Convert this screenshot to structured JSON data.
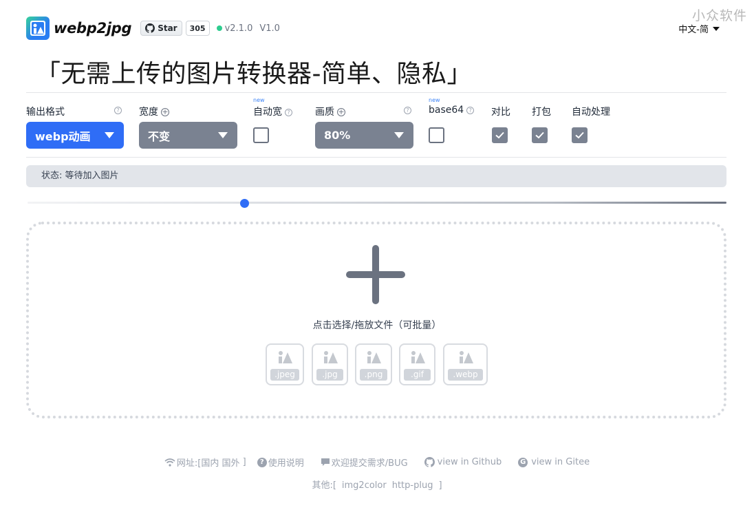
{
  "watermark": "小众软件",
  "header": {
    "brand": "webp2jpg",
    "star_label": "Star",
    "star_count": "305",
    "version": "v2.1.0",
    "version2": "V1.0",
    "language": "中文-简"
  },
  "title": "「无需上传的图片转换器-简单、隐私」",
  "options": {
    "output_format": {
      "label": "输出格式",
      "value": "webp动画"
    },
    "width": {
      "label": "宽度",
      "value": "不变"
    },
    "auto_width": {
      "new": "new",
      "label": "自动宽",
      "checked": false
    },
    "quality": {
      "label": "画质",
      "value": "80%"
    },
    "base64": {
      "new": "new",
      "label": "base64",
      "checked": false
    },
    "compare": {
      "label": "对比",
      "checked": true
    },
    "pack": {
      "label": "打包",
      "checked": true
    },
    "auto_process": {
      "label": "自动处理",
      "checked": true
    }
  },
  "status": "状态: 等待加入图片",
  "slider_value": 0.31,
  "dropzone": {
    "text": "点击选择/拖放文件（可批量）",
    "file_types": [
      ".jpeg",
      ".jpg",
      ".png",
      ".gif",
      ".webp"
    ]
  },
  "footer": {
    "site_label": "网址:[",
    "site_domestic": "国内",
    "site_foreign": "国外",
    "site_close": "]",
    "help": "使用说明",
    "feedback": "欢迎提交需求/BUG",
    "github": "view in Github",
    "gitee": "view in Gitee",
    "other_label": "其他:[",
    "other_1": "img2color",
    "other_2": "http-plug",
    "other_close": "]"
  },
  "colors": {
    "accent": "#2f6df6",
    "gray_control": "#7a8291",
    "status_bg": "#e2e5ea"
  },
  "icons": [
    "logo-icon",
    "github-icon",
    "help-icon",
    "plus-circle-icon",
    "check-icon",
    "add-icon",
    "image-icon",
    "wifi-icon",
    "question-icon",
    "chat-icon",
    "gitee-icon"
  ]
}
